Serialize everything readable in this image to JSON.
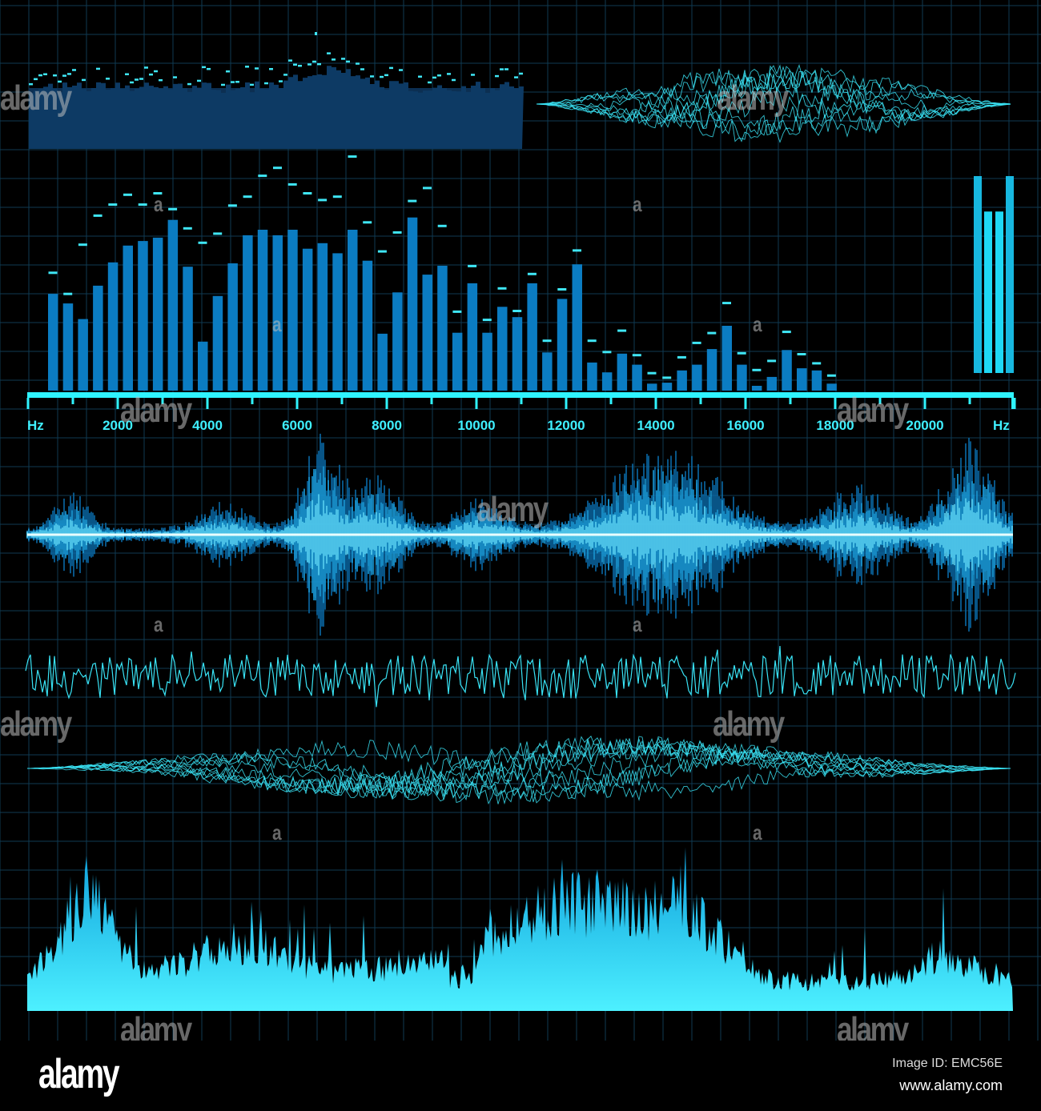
{
  "colors": {
    "grid": "#0f3a52",
    "bar": "#0b7cc2",
    "peak": "#3fe6f5",
    "axis": "#2ff3ff",
    "wave": "#39e3f5",
    "panel": "#0c2f52",
    "meter": "#1fd8f5"
  },
  "chart_data": {
    "type": "bar",
    "title": "",
    "xlabel": "Hz",
    "ylabel": "",
    "x_unit_left": "Hz",
    "x_unit_right": "Hz",
    "xlim": [
      0,
      22000
    ],
    "ylim": [
      0,
      100
    ],
    "x_ticks": [
      "2000",
      "4000",
      "6000",
      "8000",
      "10000",
      "12000",
      "14000",
      "16000",
      "18000",
      "20000"
    ],
    "series": [
      {
        "name": "level",
        "values": [
          40.3,
          36.3,
          29.8,
          43.7,
          53.4,
          60.4,
          62.3,
          63.7,
          71.1,
          51.6,
          20.4,
          39.4,
          53,
          64.7,
          67,
          64.7,
          67,
          59.1,
          61.4,
          57.2,
          67,
          54.1,
          23.7,
          40.9,
          72.1,
          48.3,
          52,
          24.1,
          44.7,
          24.1,
          34.9,
          30.6,
          44.7,
          15.9,
          38.2,
          52.6,
          11.7,
          7.6,
          15.4,
          10.8,
          2.9,
          3.3,
          8.4,
          10.8,
          17.3,
          27,
          10.8,
          2,
          5.7,
          16.9,
          9.3,
          8.4,
          2.9
        ]
      },
      {
        "name": "peak",
        "values": [
          48.9,
          40.1,
          60.6,
          72.7,
          77.3,
          81.4,
          77.3,
          82,
          75.4,
          67.4,
          61.4,
          65.2,
          76.9,
          80.6,
          89.3,
          92.6,
          85.7,
          82,
          79.2,
          80.6,
          97.3,
          69.9,
          57.8,
          65.7,
          78.8,
          84.2,
          68.4,
          32.7,
          51.7,
          29.3,
          42.4,
          33,
          48.4,
          20.6,
          42,
          58.2,
          20.6,
          15.9,
          24.8,
          14.6,
          7.1,
          5.2,
          13.7,
          19.7,
          23.8,
          36.3,
          15.4,
          8.4,
          12.2,
          24.3,
          15,
          11.2,
          6.1
        ]
      }
    ],
    "meter": {
      "type": "bar",
      "values": [
        100,
        82,
        82,
        100
      ],
      "peak_fraction": 0.85
    }
  },
  "watermarks": [
    "alamy",
    "a"
  ],
  "footer": {
    "logo": "alamy",
    "image_id": "Image ID: EMC56E",
    "url": "www.alamy.com"
  }
}
